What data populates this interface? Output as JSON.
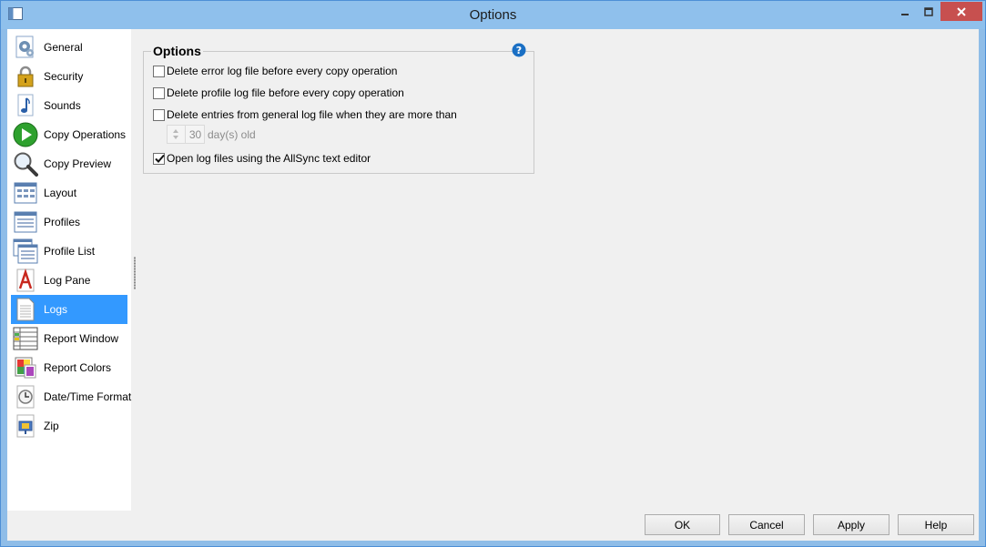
{
  "window": {
    "title": "Options"
  },
  "sidebar": {
    "items": [
      {
        "label": "General",
        "icon": "gear-page-icon"
      },
      {
        "label": "Security",
        "icon": "padlock-icon"
      },
      {
        "label": "Sounds",
        "icon": "music-note-icon"
      },
      {
        "label": "Copy Operations",
        "icon": "play-icon"
      },
      {
        "label": "Copy Preview",
        "icon": "magnifier-icon"
      },
      {
        "label": "Layout",
        "icon": "layout-grid-icon"
      },
      {
        "label": "Profiles",
        "icon": "profiles-list-icon"
      },
      {
        "label": "Profile List",
        "icon": "profile-list-icon"
      },
      {
        "label": "Log Pane",
        "icon": "font-a-icon"
      },
      {
        "label": "Logs",
        "icon": "document-icon",
        "selected": true
      },
      {
        "label": "Report Window",
        "icon": "report-table-icon"
      },
      {
        "label": "Report Colors",
        "icon": "color-palette-icon"
      },
      {
        "label": "Date/Time Format",
        "icon": "clock-icon"
      },
      {
        "label": "Zip",
        "icon": "zip-icon"
      }
    ]
  },
  "options": {
    "title": "Options",
    "checks": [
      {
        "label": "Delete error log file before every copy operation",
        "checked": false
      },
      {
        "label": "Delete profile log file before every copy operation",
        "checked": false
      },
      {
        "label": "Delete entries from general log file when they are more than",
        "checked": false
      },
      {
        "label": "Open log files using the AllSync text editor",
        "checked": true
      }
    ],
    "days_value": "30",
    "days_suffix": "day(s) old"
  },
  "buttons": {
    "ok": "OK",
    "cancel": "Cancel",
    "apply": "Apply",
    "help": "Help"
  },
  "colors": {
    "selection": "#3399ff",
    "titlebar": "#8fc0ec",
    "close": "#c7504f",
    "help_icon": "#1a6fc4"
  }
}
